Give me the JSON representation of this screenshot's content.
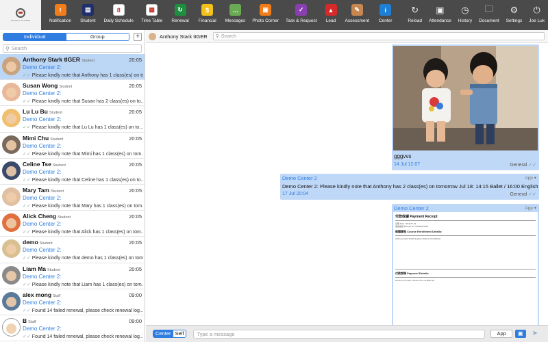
{
  "toolbar": {
    "logo_text": "SCHOOL SYSTEM",
    "items": [
      {
        "label": "Notification",
        "icon": "notification-icon",
        "color": "#f07c1a"
      },
      {
        "label": "Student",
        "icon": "student-card-icon",
        "color": "#1f2f6b"
      },
      {
        "label": "Daily Schedule",
        "icon": "calendar-icon",
        "color": "#ffffff"
      },
      {
        "label": "Time Table",
        "icon": "timetable-icon",
        "color": "#ffffff"
      },
      {
        "label": "Renewal",
        "icon": "renewal-icon",
        "color": "#1e8f3e"
      },
      {
        "label": "Financial",
        "icon": "dollar-icon",
        "color": "#f2c21a"
      },
      {
        "label": "Messages",
        "icon": "chat-bubble-icon",
        "color": "#6aaa55"
      },
      {
        "label": "Photo Corner",
        "icon": "photo-icon",
        "color": "#f07c1a"
      },
      {
        "label": "Task & Request",
        "icon": "checkbox-icon",
        "color": "#8a3fb0"
      },
      {
        "label": "Lead",
        "icon": "lead-icon",
        "color": "#d42a2a"
      },
      {
        "label": "Assessment",
        "icon": "pencil-icon",
        "color": "#c8874e"
      },
      {
        "label": "Center",
        "icon": "info-icon",
        "color": "#1e7fd6"
      }
    ],
    "right_items": [
      {
        "label": "Reload",
        "icon": "reload-icon"
      },
      {
        "label": "Attendance",
        "icon": "scan-icon"
      },
      {
        "label": "History",
        "icon": "history-icon"
      },
      {
        "label": "Document",
        "icon": "folder-icon"
      },
      {
        "label": "Settings",
        "icon": "gear-icon"
      },
      {
        "label": "Joe Luk",
        "icon": "power-icon"
      }
    ]
  },
  "left": {
    "tab_individual": "Individual",
    "tab_group": "Group",
    "plus": "+",
    "search_placeholder": "Search",
    "chats": [
      {
        "name": "Anthony Stark tIGER",
        "role": "Student",
        "time": "20:05",
        "sub": "Demo Center 2:",
        "preview": "Please kindly note that Anthony has 1 class(es) on to...",
        "selected": true,
        "av": "#c9a27e"
      },
      {
        "name": "Susan Wong",
        "role": "Student",
        "time": "20:05",
        "sub": "Demo Center 2:",
        "preview": "Please kindly note that Susan has 2 class(es) on to...",
        "selected": false,
        "av": "#e8b89a"
      },
      {
        "name": "Lu Lu Bu",
        "role": "Student",
        "time": "20:05",
        "sub": "Demo Center 2:",
        "preview": "Please kindly note that Lu Lu has 1 class(es) on to...",
        "selected": false,
        "av": "#f0c070"
      },
      {
        "name": "Mimi Chu",
        "role": "Student",
        "time": "20:05",
        "sub": "Demo Center 2:",
        "preview": "Please kindly note that Mimi has 1 class(es) on tom...",
        "selected": false,
        "av": "#7a6a5e"
      },
      {
        "name": "Celine Tse",
        "role": "Student",
        "time": "20:05",
        "sub": "Demo Center 2:",
        "preview": "Please kindly note that Celine has 1 class(es) on to...",
        "selected": false,
        "av": "#3a4a6a"
      },
      {
        "name": "Mary Tam",
        "role": "Student",
        "time": "20:05",
        "sub": "Demo Center 2:",
        "preview": "Please kindly note that Mary has 1 class(es) on tom...",
        "selected": false,
        "av": "#e0c0a0"
      },
      {
        "name": "Alick Cheng",
        "role": "Student",
        "time": "20:05",
        "sub": "Demo Center 2:",
        "preview": "Please kindly note that Alick has 1 class(es) on tom...",
        "selected": false,
        "av": "#e07040"
      },
      {
        "name": "demo",
        "role": "Student",
        "time": "20:05",
        "sub": "Demo Center 2:",
        "preview": "Please kindly note that demo has 1 class(es) on tom...",
        "selected": false,
        "av": "#d8c090"
      },
      {
        "name": "Liam Ma",
        "role": "Student",
        "time": "20:05",
        "sub": "Demo Center 2:",
        "preview": "Please kindly note that Liam has 1 class(es) on tom...",
        "selected": false,
        "av": "#8a8a8a"
      },
      {
        "name": "alex mong",
        "role": "Staff",
        "time": "09:00",
        "sub": "Demo Center 2:",
        "preview": "Found 14 failed renewal, please check renewal log...",
        "selected": false,
        "av": "#5a7a9a"
      },
      {
        "name": "B",
        "role": "Staff",
        "time": "09:00",
        "sub": "Demo Center 2:",
        "preview": "Found 14 failed renewal, please check renewal log...",
        "selected": false,
        "av": "#ffffff"
      }
    ]
  },
  "chat": {
    "header_name": "Anthony Stark tIGER",
    "search_placeholder": "Search",
    "msg1": {
      "caption": "gggvvs",
      "date": "14 Jul 12:07",
      "meta": "General"
    },
    "msg2": {
      "head": "Demo Center 2",
      "app": "App",
      "text": "Demo Center 2: Please kindly note that Anthony has 2 class(es) on tomorrow Jul 18: 14:15 Ballet / 16:00 English",
      "date": "17 Jul 20:04",
      "meta": "General"
    },
    "msg3": {
      "head": "Demo Center 2",
      "app": "App",
      "receipt_title": "付款收據 Payment Receipt",
      "receipt_date": "日期 Date: 2019-07-19",
      "receipt_no": "收據編號 Receipt No: R0000275401",
      "section1": "報讀課程 Course Enrollment Details:",
      "student_row": "Anthony Stark tIGER    English | ENG1-4    $1,000.00",
      "section2": "付款詳情 Payment Details:",
      "pay_row": "2019-07-19    Cash    275401    Joe Luk    $500.00"
    }
  },
  "input": {
    "center": "Center",
    "self": "Self",
    "placeholder": "Type a message",
    "app": "App"
  }
}
